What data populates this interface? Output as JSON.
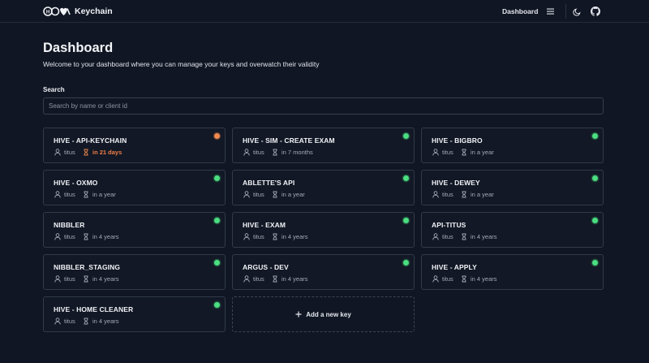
{
  "app": {
    "brand": "Keychain",
    "logo_text": "HIVE"
  },
  "nav": {
    "link_label": "Dashboard",
    "menu_icon": "menu-icon",
    "theme_icon": "moon-icon",
    "repo_icon": "github-icon"
  },
  "page": {
    "title": "Dashboard",
    "subtitle": "Welcome to your dashboard where you can manage your keys and overwatch their validity"
  },
  "search": {
    "label": "Search",
    "placeholder": "Search by name or client id",
    "value": ""
  },
  "colors": {
    "ok": "#4ade80",
    "warning": "#f28a4f",
    "background": "#101623"
  },
  "keys": [
    {
      "name": "HIVE - API-KEYCHAIN",
      "owner": "titus",
      "expires": "in 21 days",
      "status": "warn"
    },
    {
      "name": "HIVE - SIM - CREATE EXAM",
      "owner": "titus",
      "expires": "in 7 months",
      "status": "ok"
    },
    {
      "name": "HIVE - BIGBRO",
      "owner": "titus",
      "expires": "in a year",
      "status": "ok"
    },
    {
      "name": "HIVE - OXMO",
      "owner": "titus",
      "expires": "in a year",
      "status": "ok"
    },
    {
      "name": "ABLETTE'S API",
      "owner": "titus",
      "expires": "in a year",
      "status": "ok"
    },
    {
      "name": "HIVE - DEWEY",
      "owner": "titus",
      "expires": "in a year",
      "status": "ok"
    },
    {
      "name": "NIBBLER",
      "owner": "titus",
      "expires": "in 4 years",
      "status": "ok"
    },
    {
      "name": "HIVE - EXAM",
      "owner": "titus",
      "expires": "in 4 years",
      "status": "ok"
    },
    {
      "name": "API-TITUS",
      "owner": "titus",
      "expires": "in 4 years",
      "status": "ok"
    },
    {
      "name": "NIBBLER_STAGING",
      "owner": "titus",
      "expires": "in 4 years",
      "status": "ok"
    },
    {
      "name": "ARGUS - DEV",
      "owner": "titus",
      "expires": "in 4 years",
      "status": "ok"
    },
    {
      "name": "HIVE - APPLY",
      "owner": "titus",
      "expires": "in 4 years",
      "status": "ok"
    },
    {
      "name": "HIVE - HOME CLEANER",
      "owner": "titus",
      "expires": "in 4 years",
      "status": "ok"
    }
  ],
  "add_key": {
    "label": "Add a new key"
  }
}
